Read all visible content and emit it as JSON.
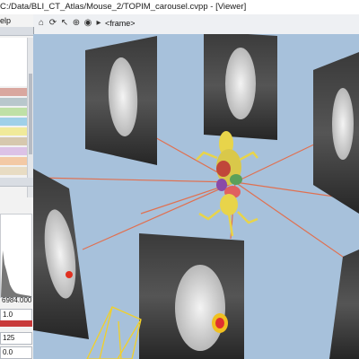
{
  "window": {
    "title": "C:/Data/BLI_CT_Atlas/Mouse_2/TOPIM_carousel.cvpp - [Viewer]",
    "menu_fragment": "elp"
  },
  "viewer": {
    "frame_label": "<frame>"
  },
  "left_panel": {
    "swatch_colors": [
      "#d9a79f",
      "#b8c7cc",
      "#bfe0a6",
      "#9fd0e8",
      "#f0ea9a",
      "#d6c8ae",
      "#dcc2e6",
      "#f3c9a5",
      "#e8dcc3"
    ],
    "histogram_max": "6984.000",
    "field_1": "1.0",
    "field_2": "125",
    "field_3": "0.0"
  },
  "colors": {
    "viewer_background": "#a7c1db",
    "connector_lines": "#e07050",
    "accent_red": "#c83a3a"
  }
}
